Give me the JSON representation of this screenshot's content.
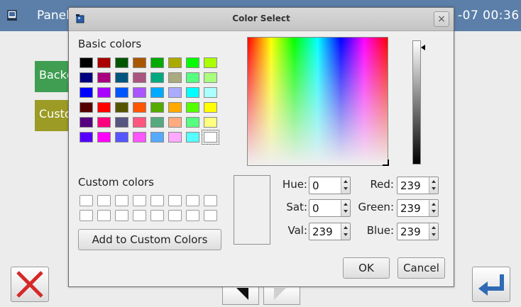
{
  "app": {
    "panel_label": "Panel",
    "clock": "-07  00:36",
    "buttons": [
      "Backg",
      "Custo"
    ]
  },
  "dialog": {
    "title": "Color Select",
    "close_glyph": "×",
    "basic_colors_label": "Basic colors",
    "custom_colors_label": "Custom colors",
    "add_custom_label": "Add to Custom Colors",
    "ok_label": "OK",
    "cancel_label": "Cancel",
    "basic_colors": [
      "#000000",
      "#aa0000",
      "#005500",
      "#aa5500",
      "#00aa00",
      "#aaaa00",
      "#00ff00",
      "#aaff00",
      "#00007f",
      "#aa007f",
      "#00557f",
      "#aa557f",
      "#00aa7f",
      "#aaaa7f",
      "#55ff7f",
      "#aaff7f",
      "#0000ff",
      "#aa00ff",
      "#0055ff",
      "#aa55ff",
      "#00aaff",
      "#aaaaff",
      "#00ffff",
      "#aaffff",
      "#550000",
      "#ff0000",
      "#555500",
      "#ff5500",
      "#55aa00",
      "#ffaa00",
      "#55ff00",
      "#ffff00",
      "#55007f",
      "#ff007f",
      "#55557f",
      "#ff557f",
      "#55aa7f",
      "#ffaa7f",
      "#55ff7f",
      "#ffff7f",
      "#5500ff",
      "#ff00ff",
      "#5555ff",
      "#ff55ff",
      "#55aaff",
      "#ffaaff",
      "#55ffff",
      "#ffffff"
    ],
    "selected_swatch_index": 47,
    "custom_colors_count": 16,
    "fields": {
      "hue": {
        "label": "Hue:",
        "value": "0"
      },
      "sat": {
        "label": "Sat:",
        "value": "0"
      },
      "val": {
        "label": "Val:",
        "value": "239"
      },
      "red": {
        "label": "Red:",
        "value": "239"
      },
      "green": {
        "label": "Green:",
        "value": "239"
      },
      "blue": {
        "label": "Blue:",
        "value": "239"
      }
    },
    "current_color": "#efefef"
  },
  "icons": {
    "cancel": "red-x-icon",
    "enter": "enter-arrow-icon"
  },
  "colors": {
    "topbar": "#5b7fa8",
    "cancel_x": "#d62828",
    "enter_arrow": "#2f6ab5"
  }
}
